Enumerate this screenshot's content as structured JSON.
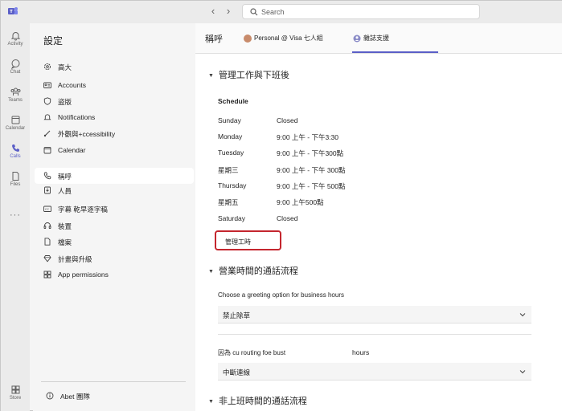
{
  "search": {
    "placeholder": "Search"
  },
  "rail": [
    {
      "label": "Activity",
      "icon": "bell-icon"
    },
    {
      "label": "Chat",
      "icon": "chat-icon"
    },
    {
      "label": "Teams",
      "icon": "teams-icon"
    },
    {
      "label": "Calendar",
      "icon": "calendar-icon"
    },
    {
      "label": "Calls",
      "icon": "phone-icon",
      "active": true
    },
    {
      "label": "Files",
      "icon": "file-icon"
    },
    {
      "label": "Store",
      "icon": "store-icon"
    }
  ],
  "settings": {
    "title": "設定",
    "menu": [
      {
        "label": "高大",
        "icon": "gear-icon"
      },
      {
        "label": "Accounts",
        "icon": "id-card-icon"
      },
      {
        "label": "盜版",
        "icon": "shield-icon"
      },
      {
        "label": "Notifications",
        "icon": "bell-icon"
      },
      {
        "label": "外觀與+ccessibility",
        "icon": "brush-icon"
      },
      {
        "label": "Calendar",
        "icon": "calendar-icon"
      },
      {
        "label": "稱呼",
        "icon": "phone-icon",
        "active": true
      },
      {
        "label": "人員",
        "icon": "person-download-icon"
      },
      {
        "label": "字幕 乾早逐字稿",
        "icon": "captions-icon"
      },
      {
        "label": "裝置",
        "icon": "headset-icon"
      },
      {
        "label": "檔案",
        "icon": "document-icon"
      },
      {
        "label": "計畫與升級",
        "icon": "diamond-icon"
      },
      {
        "label": "App   permissions",
        "icon": "apps-icon"
      }
    ],
    "about": "Abet 團隊"
  },
  "main": {
    "title": "稱呼",
    "tabs": [
      {
        "label": "Personal  @  Visa 七人組"
      },
      {
        "label": "雜誌支援"
      }
    ],
    "section1": "管理工作與下班後",
    "schedule_title": "Schedule",
    "schedule": [
      {
        "day": "Sunday",
        "hours": "Closed"
      },
      {
        "day": "Monday",
        "hours": "9:00 上午 - 下午3:30"
      },
      {
        "day": "Tuesday",
        "hours": "9:00 上午 - 下午300點"
      },
      {
        "day": "星期三",
        "hours": "9:00 上午 - 下午 300點"
      },
      {
        "day": "Thursday",
        "hours": "9:00 上午 - 下午 500點"
      },
      {
        "day": "星期五",
        "hours": "9:00 上午500點"
      },
      {
        "day": "Saturday",
        "hours": "Closed"
      }
    ],
    "manage_button": "管理工時",
    "section2": "營業時間的通話流程",
    "greeting_label": "Choose a greeting option for business hours",
    "greeting_value": "禁止除草",
    "routing_label": "因為 cu routing foe bust",
    "routing_hours": "hours",
    "routing_value": "中斷連線",
    "section3": "非上班時間的通話流程"
  }
}
